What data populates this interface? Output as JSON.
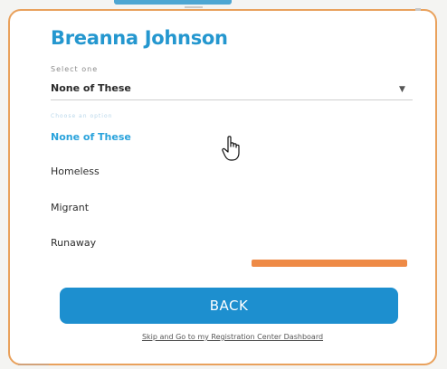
{
  "header": {
    "name": "Breanna Johnson"
  },
  "field": {
    "label": "Select one",
    "value": "None of These",
    "hint": "Choose an option"
  },
  "options": [
    "None of These",
    "Homeless",
    "Migrant",
    "Runaway"
  ],
  "selected_index": 0,
  "buttons": {
    "back": "BACK"
  },
  "footer": {
    "link": "Skip and Go to my Registration Center Dashboard"
  },
  "colors": {
    "accent_blue": "#2497cf",
    "button_blue": "#1d8fcf",
    "accent_orange": "#ee8a46",
    "card_border": "#e9a15c"
  },
  "icons": {
    "caret": "chevron-down-icon",
    "cursor": "hand-pointer-icon"
  }
}
